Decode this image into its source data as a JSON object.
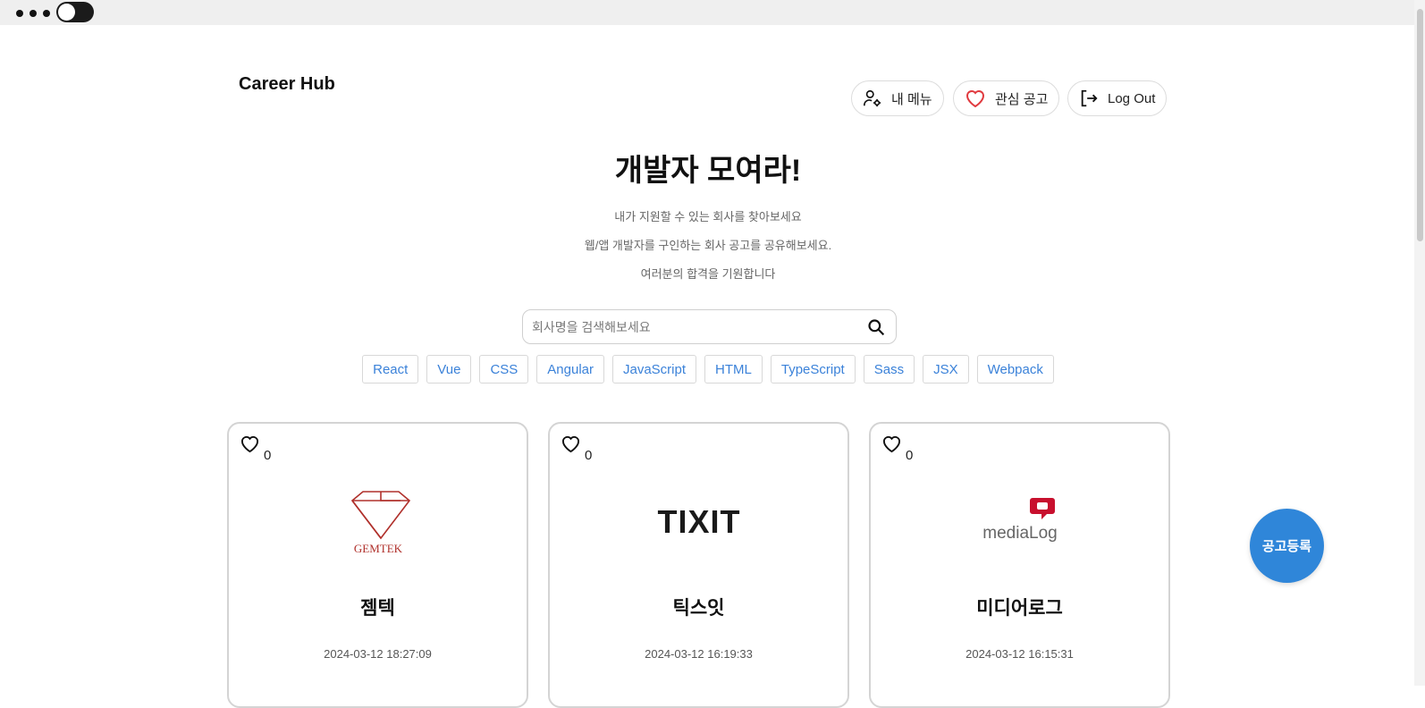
{
  "header": {
    "brand": "Career Hub",
    "my_menu_label": "내 메뉴",
    "favorites_label": "관심 공고",
    "logout_label": "Log Out"
  },
  "hero": {
    "title": "개발자 모여라!",
    "line1": "내가 지원할 수 있는 회사를 찾아보세요",
    "line2": "웹/앱 개발자를 구인하는 회사 공고를 공유해보세요.",
    "line3": "여러분의 합격을 기원합니다"
  },
  "search": {
    "placeholder": "회사명을 검색해보세요",
    "value": ""
  },
  "tags": [
    "React",
    "Vue",
    "CSS",
    "Angular",
    "JavaScript",
    "HTML",
    "TypeScript",
    "Sass",
    "JSX",
    "Webpack"
  ],
  "cards": [
    {
      "likes": "0",
      "logo_text": "GEMTEK",
      "company": "젬텍",
      "date": "2024-03-12 18:27:09"
    },
    {
      "likes": "0",
      "logo_text": "TIXIT",
      "company": "틱스잇",
      "date": "2024-03-12 16:19:33"
    },
    {
      "likes": "0",
      "logo_text": "mediaLog",
      "company": "미디어로그",
      "date": "2024-03-12 16:15:31"
    }
  ],
  "fab": {
    "label": "공고등록"
  },
  "colors": {
    "accent": "#2f86d9",
    "tag_text": "#3b82d9",
    "favorite_heart": "#e0393e"
  }
}
